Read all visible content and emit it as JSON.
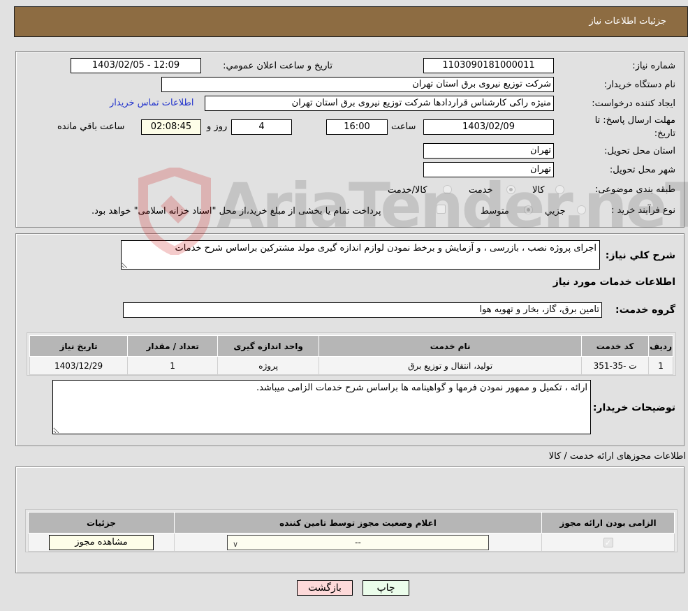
{
  "header": {
    "title": "جزئیات اطلاعات نیاز"
  },
  "form": {
    "need_number": {
      "label": "شماره نیاز:",
      "value": "1103090181000011"
    },
    "announce_datetime": {
      "label": "تاریخ و ساعت اعلان عمومي:",
      "value": "1403/02/05 - 12:09"
    },
    "buyer_org": {
      "label": "نام دستگاه خریدار:",
      "value": "شرکت توزیع نیروی برق استان تهران"
    },
    "requester": {
      "label": "ایجاد کننده درخواست:",
      "value": "منیژه راکی کارشناس قراردادها شرکت توزیع نیروی برق استان تهران"
    },
    "buyer_contact_link": "اطلاعات تماس خریدار",
    "deadline": {
      "label": "مهلت ارسال پاسخ: تا تاریخ:",
      "date": "1403/02/09",
      "time_label": "ساعت",
      "time": "16:00",
      "days": "4",
      "days_label": "روز و",
      "remaining": "02:08:45",
      "remaining_label": "ساعت باقي مانده"
    },
    "delivery_province": {
      "label": "استان محل تحویل:",
      "value": "تهران"
    },
    "delivery_city": {
      "label": "شهر محل تحویل:",
      "value": "تهران"
    },
    "category": {
      "label": "طبقه بندی موضوعی:",
      "options": [
        "کالا",
        "خدمت",
        "کالا/خدمت"
      ],
      "selected": "خدمت"
    },
    "purchase_process": {
      "label": "نوع فرآیند خرید :",
      "options": [
        "جزيي",
        "متوسط"
      ],
      "selected": "متوسط",
      "treasury_note": "پرداخت تمام یا بخشی از مبلغ خرید،از محل \"اسناد خزانه اسلامی\" خواهد بود."
    }
  },
  "description": {
    "label": "شرح کلي نیاز:",
    "value": "اجرای پروژه نصب ، بازرسی ، و آزمایش و برخط نمودن لوازم اندازه گیری مولد مشترکین براساس شرح خدمات"
  },
  "services": {
    "section_title": "اطلاعات خدمات مورد نیاز",
    "group_label": "گروه خدمت:",
    "group_value": "تامین برق، گاز، بخار و تهویه هوا",
    "table": {
      "headers": [
        "ردیف",
        "کد خدمت",
        "نام خدمت",
        "واحد اندازه گیری",
        "تعداد / مقدار",
        "تاریخ نیاز"
      ],
      "rows": [
        [
          "1",
          "ت -35-351",
          "تولید، انتقال و توزیع برق",
          "پروژه",
          "1",
          "1403/12/29"
        ]
      ]
    }
  },
  "buyer_notes": {
    "label": "توضیحات خریدار:",
    "value": "ارائه ، تکمیل و ممهور نمودن فرمها و گواهینامه ها براساس شرح خدمات الزامی میباشد."
  },
  "permits": {
    "section_title": "اطلاعات مجوزهای ارائه خدمت / کالا",
    "headers": [
      "الزامی بودن ارائه مجوز",
      "اعلام وضعیت مجوز توسط تامین کننده",
      "جزئیات"
    ],
    "row": {
      "required_checked": true,
      "status_select": "--",
      "view_button": "مشاهده مجوز"
    }
  },
  "actions": {
    "print": "چاپ",
    "back": "بازگشت"
  },
  "watermark": {
    "text": "AriaTender.neT"
  }
}
